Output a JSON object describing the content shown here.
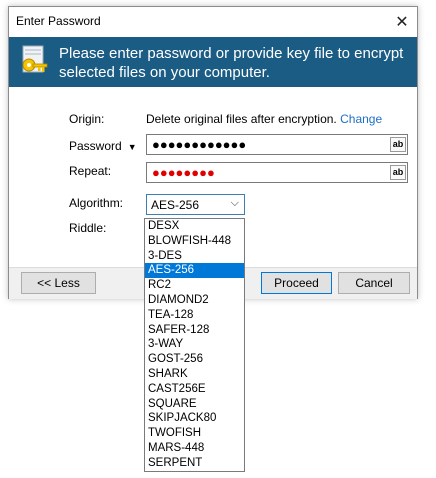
{
  "window": {
    "title": "Enter Password",
    "close_glyph": "✕"
  },
  "banner": {
    "icon": "key-file-icon",
    "message": "Please enter password or provide key file to encrypt selected files on your computer."
  },
  "form": {
    "origin_label": "Origin:",
    "origin_text": "Delete original files after encryption.",
    "origin_link": "Change",
    "password_label": "Password",
    "password_mask": "●●●●●●●●●●●●",
    "repeat_label": "Repeat:",
    "repeat_mask": "●●●●●●●●",
    "reveal_label": "ab",
    "algorithm_label": "Algorithm:",
    "algorithm_value": "AES-256",
    "riddle_label": "Riddle:"
  },
  "footer": {
    "less_label": "<< Less",
    "proceed_label": "Proceed",
    "cancel_label": "Cancel"
  },
  "algorithms": [
    "DESX",
    "BLOWFISH-448",
    "3-DES",
    "AES-256",
    "RC2",
    "DIAMOND2",
    "TEA-128",
    "SAFER-128",
    "3-WAY",
    "GOST-256",
    "SHARK",
    "CAST256E",
    "SQUARE",
    "SKIPJACK80",
    "TWOFISH",
    "MARS-448",
    "SERPENT"
  ],
  "colors": {
    "banner": "#1b5c85",
    "link": "#1e6fc6",
    "selection": "#0078d7",
    "repeat_mask": "#e00000"
  }
}
